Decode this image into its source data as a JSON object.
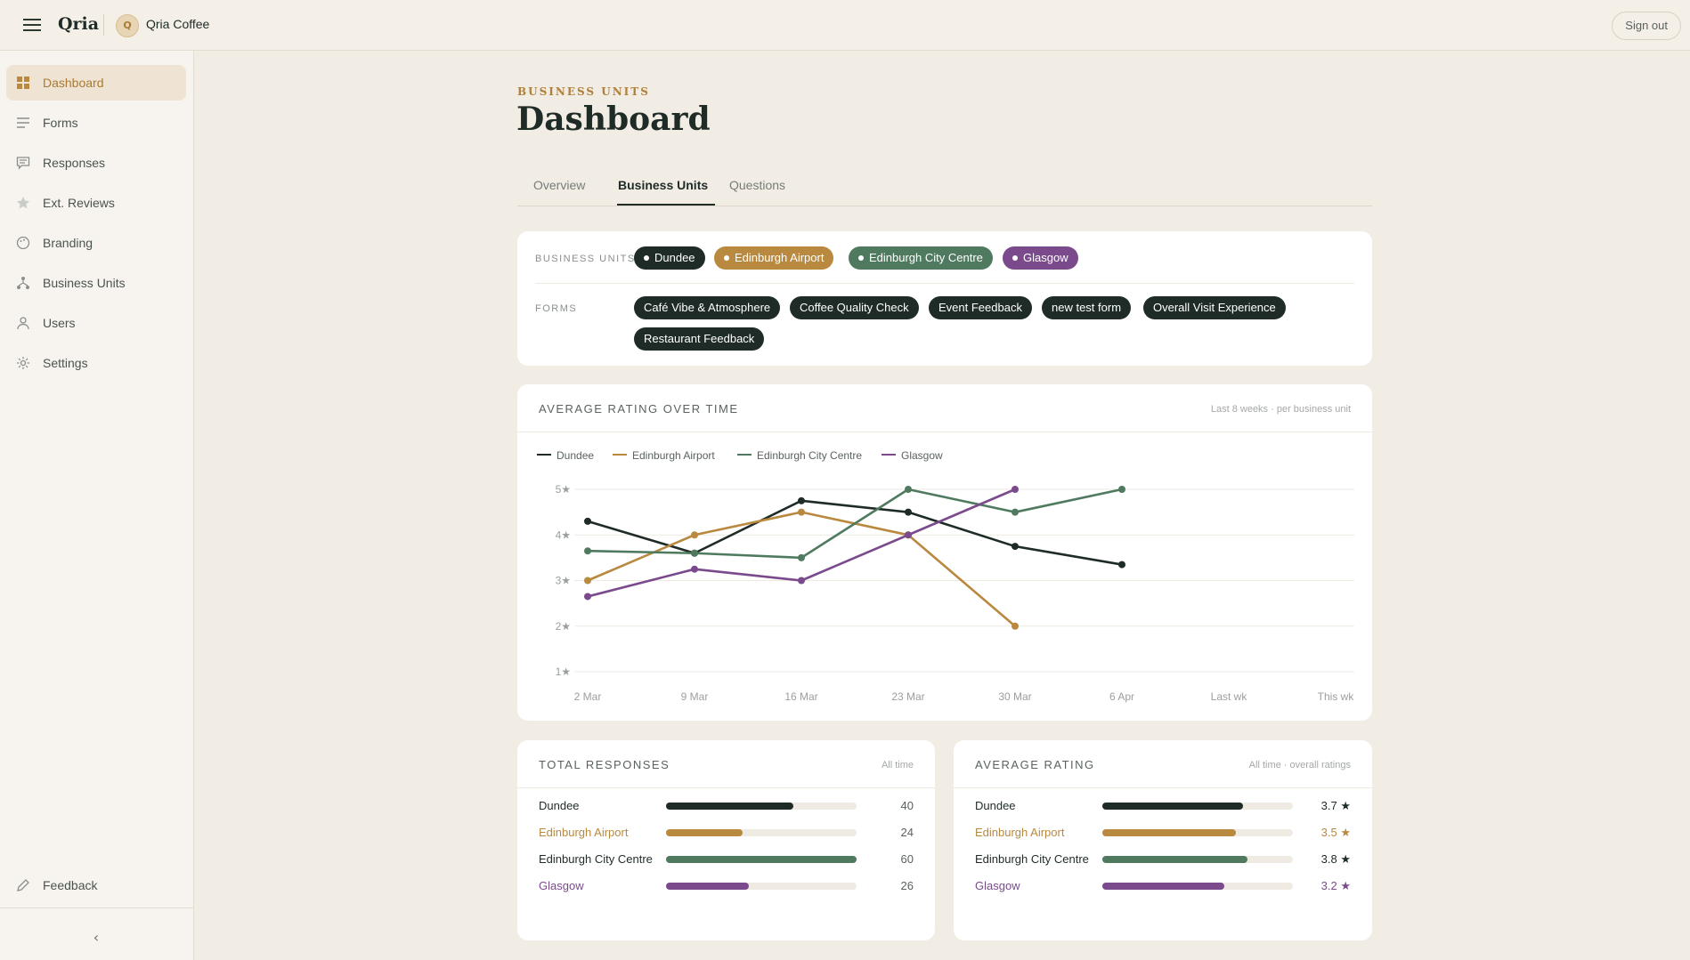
{
  "app": {
    "logo": "Qria",
    "org_initial": "Q",
    "org_name": "Qria Coffee",
    "signout": "Sign out"
  },
  "sidebar": {
    "items": [
      {
        "label": "Dashboard",
        "icon": "grid-icon",
        "active": true
      },
      {
        "label": "Forms",
        "icon": "lines-icon"
      },
      {
        "label": "Responses",
        "icon": "chat-icon"
      },
      {
        "label": "Ext. Reviews",
        "icon": "star-icon"
      },
      {
        "label": "Branding",
        "icon": "palette-icon"
      },
      {
        "label": "Business Units",
        "icon": "hierarchy-icon"
      },
      {
        "label": "Users",
        "icon": "user-icon"
      },
      {
        "label": "Settings",
        "icon": "gear-icon"
      }
    ],
    "feedback": "Feedback",
    "collapse": "‹"
  },
  "header": {
    "eyebrow": "BUSINESS UNITS",
    "title": "Dashboard"
  },
  "tabs": [
    {
      "label": "Overview"
    },
    {
      "label": "Business Units",
      "active": true
    },
    {
      "label": "Questions"
    }
  ],
  "filters": {
    "units_label": "BUSINESS UNITS",
    "forms_label": "FORMS",
    "units": [
      {
        "label": "Dundee",
        "color": "#1f2b26"
      },
      {
        "label": "Edinburgh Airport",
        "color": "#b8893f"
      },
      {
        "label": "Edinburgh City Centre",
        "color": "#4f7a60"
      },
      {
        "label": "Glasgow",
        "color": "#7a4a8c"
      }
    ],
    "forms": [
      "Café Vibe & Atmosphere",
      "Coffee Quality Check",
      "Event Feedback",
      "new test form",
      "Overall Visit Experience",
      "Restaurant Feedback"
    ]
  },
  "rating_chart": {
    "title": "AVERAGE RATING OVER TIME",
    "subtitle": "Last 8 weeks · per business unit"
  },
  "chart_data": {
    "type": "line",
    "categories": [
      "2 Mar",
      "9 Mar",
      "16 Mar",
      "23 Mar",
      "30 Mar",
      "6 Apr",
      "Last wk",
      "This wk"
    ],
    "y_ticks": [
      "1★",
      "2★",
      "3★",
      "4★",
      "5★"
    ],
    "ylim": [
      1,
      5
    ],
    "grid": true,
    "legend": "top-left",
    "series": [
      {
        "name": "Dundee",
        "color": "#1f2b26",
        "values": [
          4.3,
          3.6,
          4.75,
          4.5,
          3.75,
          3.35,
          null,
          null
        ]
      },
      {
        "name": "Edinburgh Airport",
        "color": "#b8893f",
        "values": [
          3.0,
          4.0,
          4.5,
          4.0,
          2.0,
          null,
          null,
          null
        ]
      },
      {
        "name": "Edinburgh City Centre",
        "color": "#4f7a60",
        "values": [
          3.65,
          3.6,
          3.5,
          5.0,
          4.5,
          5.0,
          null,
          null
        ]
      },
      {
        "name": "Glasgow",
        "color": "#7a4a8c",
        "values": [
          2.65,
          3.25,
          3.0,
          4.0,
          5.0,
          null,
          null,
          null
        ]
      }
    ]
  },
  "total_responses": {
    "title": "TOTAL RESPONSES",
    "subtitle": "All time",
    "max": 60,
    "rows": [
      {
        "name": "Dundee",
        "value": 40,
        "display": "40",
        "color": "#1f2b26"
      },
      {
        "name": "Edinburgh Airport",
        "value": 24,
        "display": "24",
        "color": "#b8893f"
      },
      {
        "name": "Edinburgh City Centre",
        "value": 60,
        "display": "60",
        "color": "#4f7a60"
      },
      {
        "name": "Glasgow",
        "value": 26,
        "display": "26",
        "color": "#7a4a8c"
      }
    ]
  },
  "average_rating": {
    "title": "AVERAGE RATING",
    "subtitle": "All time · overall ratings",
    "max": 5,
    "rows": [
      {
        "name": "Dundee",
        "value": 3.7,
        "display": "3.7 ★",
        "color": "#1f2b26"
      },
      {
        "name": "Edinburgh Airport",
        "value": 3.5,
        "display": "3.5 ★",
        "color": "#b8893f"
      },
      {
        "name": "Edinburgh City Centre",
        "value": 3.8,
        "display": "3.8 ★",
        "color": "#4f7a60"
      },
      {
        "name": "Glasgow",
        "value": 3.2,
        "display": "3.2 ★",
        "color": "#7a4a8c"
      }
    ]
  }
}
